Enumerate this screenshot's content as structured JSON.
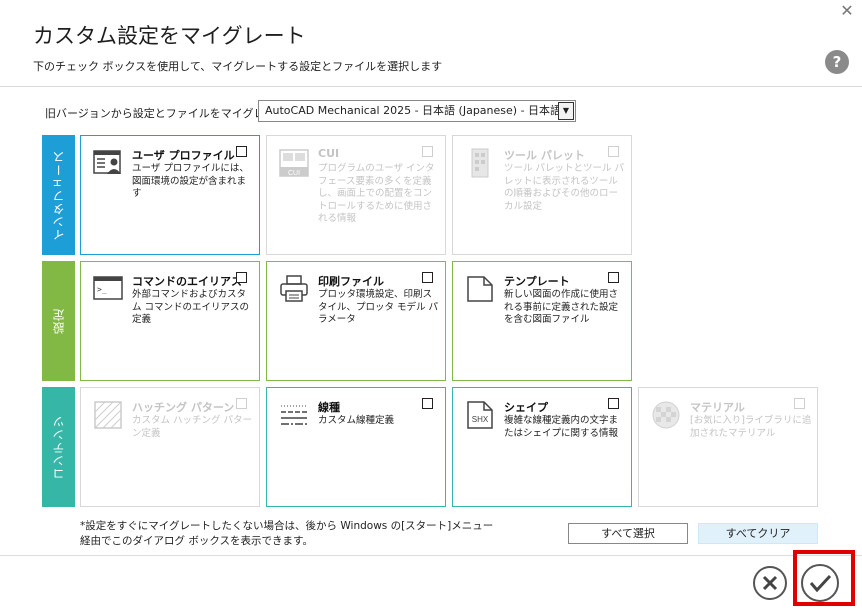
{
  "dialog": {
    "title": "カスタム設定をマイグレート",
    "subtitle": "下のチェック ボックスを使用して、マイグレートする設定とファイルを選択します",
    "help_label": "?"
  },
  "source": {
    "label": "旧バージョンから設定とファイルをマイグレート:",
    "selected": "AutoCAD Mechanical 2025 - 日本語 (Japanese) - 日本語"
  },
  "categories": {
    "interface": "インタフェース",
    "settings": "設定",
    "contents": "コンテンツ"
  },
  "cards": {
    "user_profile": {
      "title": "ユーザ プロファイル",
      "desc": "ユーザ プロファイルには、図面環境の設定が含まれます"
    },
    "cui": {
      "title": "CUI",
      "desc": "プログラムのユーザ インタフェース要素の多くを定義し、画面上での配置をコントロールするために使用される情報",
      "icon_text": "CUI"
    },
    "tool_palette": {
      "title": "ツール パレット",
      "desc": "ツール パレットとツール パレットに表示されるツールの順番およびその他のローカル設定"
    },
    "command_alias": {
      "title": "コマンドのエイリアス",
      "desc": "外部コマンドおよびカスタム コマンドのエイリアスの定義"
    },
    "plot_files": {
      "title": "印刷ファイル",
      "desc": "プロッタ環境設定、印刷スタイル、プロッタ モデル パラメータ"
    },
    "template": {
      "title": "テンプレート",
      "desc": "新しい図面の作成に使用される事前に定義された設定を含む図面ファイル"
    },
    "hatch_pattern": {
      "title": "ハッチング パターン",
      "desc": "カスタム ハッチング パターン定義"
    },
    "linetype": {
      "title": "線種",
      "desc": "カスタム線種定義"
    },
    "shape": {
      "title": "シェイプ",
      "desc": "複雑な線種定義内の文字またはシェイプに関する情報",
      "icon_text": "SHX"
    },
    "material": {
      "title": "マテリアル",
      "desc": "[お気に入り]ライブラリに追加されたマテリアル"
    }
  },
  "footer": {
    "note": "*設定をすぐにマイグレートしたくない場合は、後から Windows の[スタート]メニュー経由でこのダイアログ ボックスを表示できます。",
    "select_all": "すべて選択",
    "clear_all": "すべてクリア"
  },
  "colors": {
    "interface": "#1e9ed6",
    "settings": "#82b844",
    "contents": "#35b6a7",
    "highlight": "#e00000"
  }
}
